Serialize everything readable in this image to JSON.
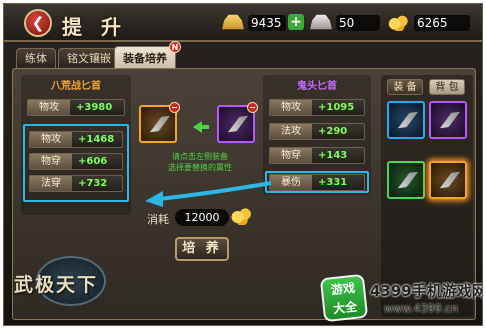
{
  "header": {
    "back_icon": "back-arrow-icon",
    "title": "提 升",
    "resources": [
      {
        "icon": "gold-ingot-icon",
        "value": "9435"
      },
      {
        "icon": "silver-ingot-icon",
        "value": "50"
      },
      {
        "icon": "gold-coins-icon",
        "value": "6265"
      }
    ],
    "plus_label": "+"
  },
  "tabs": [
    {
      "label": "练体",
      "active": false
    },
    {
      "label": "铭文镶嵌",
      "active": false
    },
    {
      "label": "装备培养",
      "active": true,
      "badge": "N"
    }
  ],
  "left_item": {
    "name": "八荒战匕首",
    "name_color": "#f2a536",
    "base_stat": {
      "key": "物攻",
      "value": "+3980"
    },
    "stats": [
      {
        "key": "物攻",
        "value": "+1468"
      },
      {
        "key": "物穿",
        "value": "+606"
      },
      {
        "key": "法穿",
        "value": "+732"
      }
    ]
  },
  "right_item": {
    "name": "鬼头匕首",
    "name_color": "#c46bff",
    "stats": [
      {
        "key": "物攻",
        "value": "+1095"
      },
      {
        "key": "法攻",
        "value": "+290"
      },
      {
        "key": "物穿",
        "value": "+143"
      },
      {
        "key": "暴伤",
        "value": "+331"
      }
    ]
  },
  "center": {
    "hint_line1": "请点击左侧装备",
    "hint_line2": "选择要替换的属性",
    "cost_label": "消耗",
    "cost_value": "12000",
    "cultivate_button": "培 养"
  },
  "inventory": {
    "tabs": [
      {
        "label": "装 备",
        "active": true
      },
      {
        "label": "背 包",
        "active": false
      }
    ]
  },
  "logo_text": "武极天下",
  "watermark": {
    "badge_line1": "游戏",
    "badge_line2": "大全",
    "text1": "4399手机游戏网",
    "text2": "www.4399.cn"
  },
  "colors": {
    "highlight_blue": "#2cb7e6",
    "stat_green": "#7bff5a",
    "hint_green": "#4fd23f"
  }
}
